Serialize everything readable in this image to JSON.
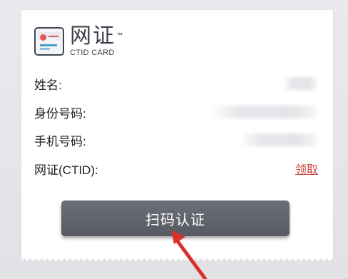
{
  "brand": {
    "title": "网证",
    "trademark": "™",
    "subtitle": "CTID CARD"
  },
  "fields": [
    {
      "label": "姓名:",
      "value_state": "blurred"
    },
    {
      "label": "身份号码:",
      "value_state": "blurred"
    },
    {
      "label": "手机号码:",
      "value_state": "blurred"
    },
    {
      "label": "网证(CTID):",
      "action_label": "领取"
    }
  ],
  "scan_button": {
    "label": "扫码认证"
  },
  "colors": {
    "button_bg": "#5f616a",
    "link": "#c84a43",
    "arrow": "#d8302a",
    "text": "#222222"
  },
  "icons": {
    "card": "id-card-icon",
    "pointer": "arrow-icon"
  }
}
